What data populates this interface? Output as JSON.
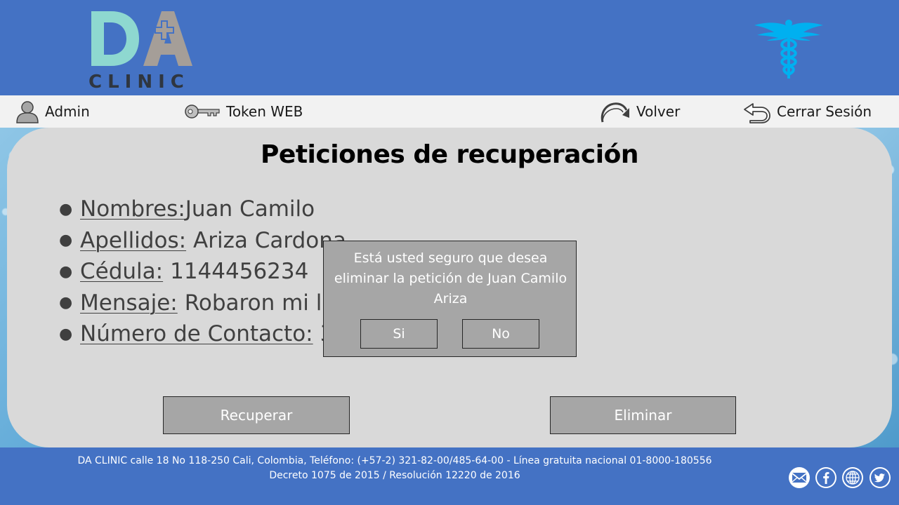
{
  "header": {
    "logo_letters": "DA",
    "logo_subtitle": "CLINIC"
  },
  "navbar": {
    "admin": "Admin",
    "token": "Token WEB",
    "volver": "Volver",
    "cerrar": "Cerrar Sesión"
  },
  "page": {
    "title": "Peticiones de recuperación",
    "details": [
      {
        "label": "Nombres: ",
        "value": "Juan Camilo"
      },
      {
        "label": "Apellidos:",
        "value": "Ariza Cardona"
      },
      {
        "label": "Cédula:",
        "value": "1144456234"
      },
      {
        "label": "Mensaje:",
        "value": "Robaron mi la"
      },
      {
        "label": "Número de Contacto:",
        "value": "3"
      }
    ],
    "btn_recuperar": "Recuperar",
    "btn_eliminar": "Eliminar"
  },
  "modal": {
    "message": "Está usted seguro que desea eliminar la petición de Juan Camilo Ariza",
    "yes": "Si",
    "no": "No"
  },
  "footer": {
    "line1": "DA CLINIC calle 18 No 118-250 Cali, Colombia, Teléfono: (+57-2) 321-82-00/485-64-00 - Línea gratuita nacional 01-8000-180556",
    "line2": "Decreto 1075 de 2015 / Resolución 12220 de 2016"
  },
  "colors": {
    "brand_blue": "#4472c4",
    "card_gray": "#d9d9d9",
    "button_gray": "#a6a6a6",
    "logo_teal": "#8ed8d0",
    "logo_taupe": "#a59e98",
    "caduceus_cyan": "#00b0f0"
  },
  "icons": [
    "user-icon",
    "key-icon",
    "redo-arrow-icon",
    "undo-arrow-icon",
    "caduceus-icon",
    "mail-icon",
    "facebook-icon",
    "globe-icon",
    "twitter-icon"
  ]
}
